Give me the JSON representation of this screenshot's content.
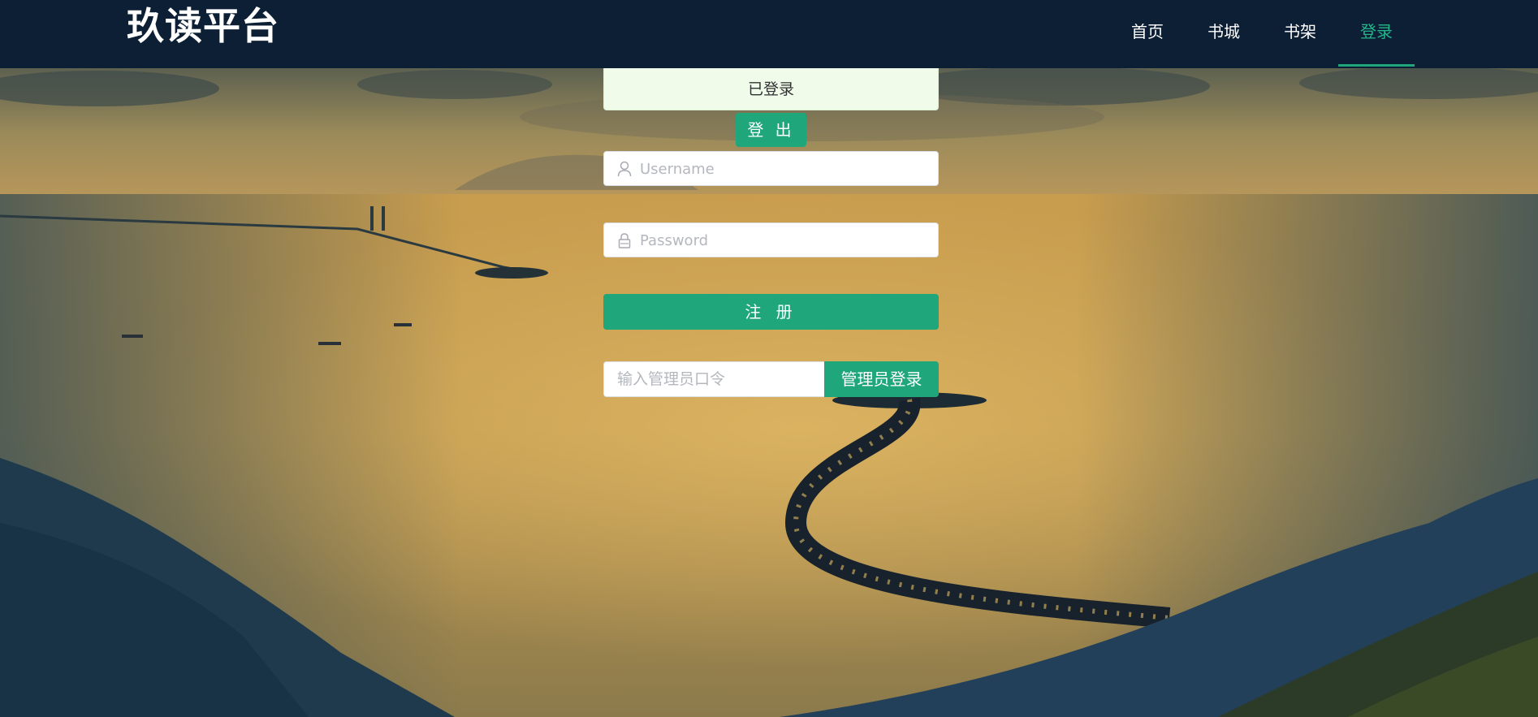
{
  "header": {
    "brand": "玖读平台",
    "nav": [
      {
        "label": "首页",
        "active": false
      },
      {
        "label": "书城",
        "active": false
      },
      {
        "label": "书架",
        "active": false
      },
      {
        "label": "登录",
        "active": true
      }
    ]
  },
  "login": {
    "status_text": "已登录",
    "logout_label": "登 出",
    "username_placeholder": "Username",
    "password_placeholder": "Password",
    "register_label": "注 册",
    "admin_placeholder": "输入管理员口令",
    "admin_login_label": "管理员登录"
  },
  "icons": {
    "username": "user-icon",
    "password": "lock-icon"
  },
  "colors": {
    "header_bg": "#0c1f34",
    "accent": "#1fa67b",
    "nav_active": "#23b68b",
    "status_bg": "#f0fbe9"
  }
}
